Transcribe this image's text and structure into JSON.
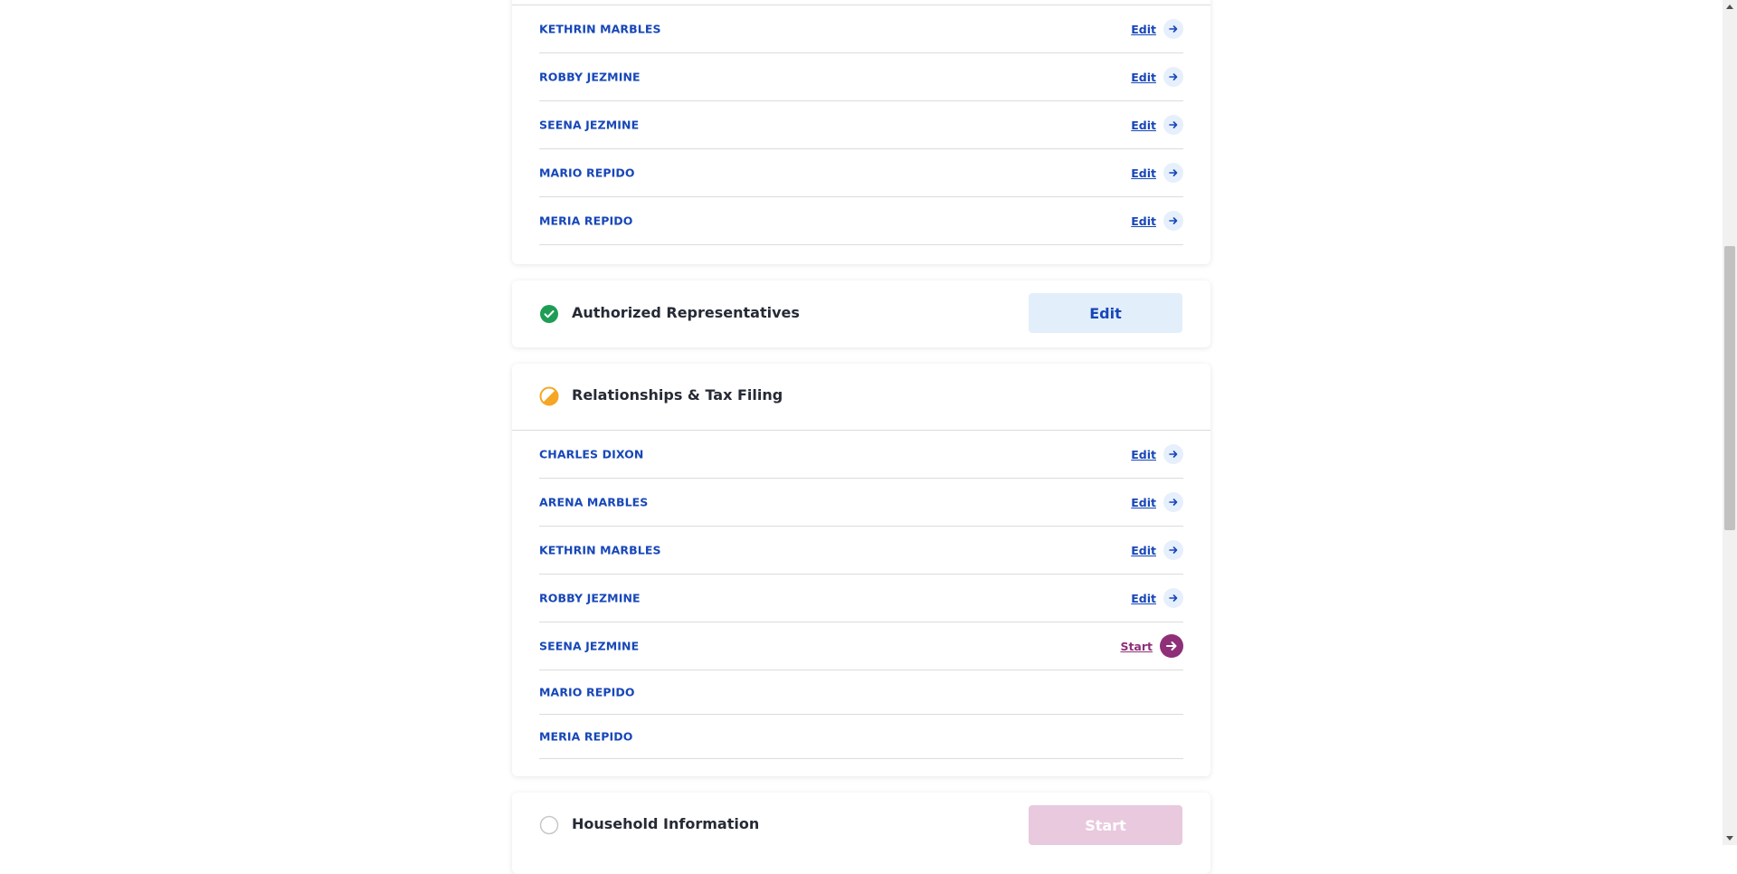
{
  "top_section": {
    "members": [
      {
        "name": "KETHRIN MARBLES",
        "action": "Edit"
      },
      {
        "name": "ROBBY JEZMINE",
        "action": "Edit"
      },
      {
        "name": "SEENA JEZMINE",
        "action": "Edit"
      },
      {
        "name": "MARIO REPIDO",
        "action": "Edit"
      },
      {
        "name": "MERIA REPIDO",
        "action": "Edit"
      }
    ]
  },
  "authorized_representatives": {
    "title": "Authorized Representatives",
    "status": "complete",
    "button_label": "Edit"
  },
  "relationships": {
    "title": "Relationships & Tax Filing",
    "status": "in-progress",
    "members": [
      {
        "name": "CHARLES DIXON",
        "action": "Edit"
      },
      {
        "name": "ARENA MARBLES",
        "action": "Edit"
      },
      {
        "name": "KETHRIN MARBLES",
        "action": "Edit"
      },
      {
        "name": "ROBBY JEZMINE",
        "action": "Edit"
      },
      {
        "name": "SEENA JEZMINE",
        "action": "Start"
      },
      {
        "name": "MARIO REPIDO",
        "action": ""
      },
      {
        "name": "MERIA REPIDO",
        "action": ""
      }
    ]
  },
  "household_information": {
    "title": "Household Information",
    "status": "not-started",
    "button_label": "Start"
  },
  "colors": {
    "link_blue": "#1747b8",
    "start_purple": "#8e2f78",
    "complete_green": "#1f9d55",
    "progress_orange": "#f5a623"
  }
}
